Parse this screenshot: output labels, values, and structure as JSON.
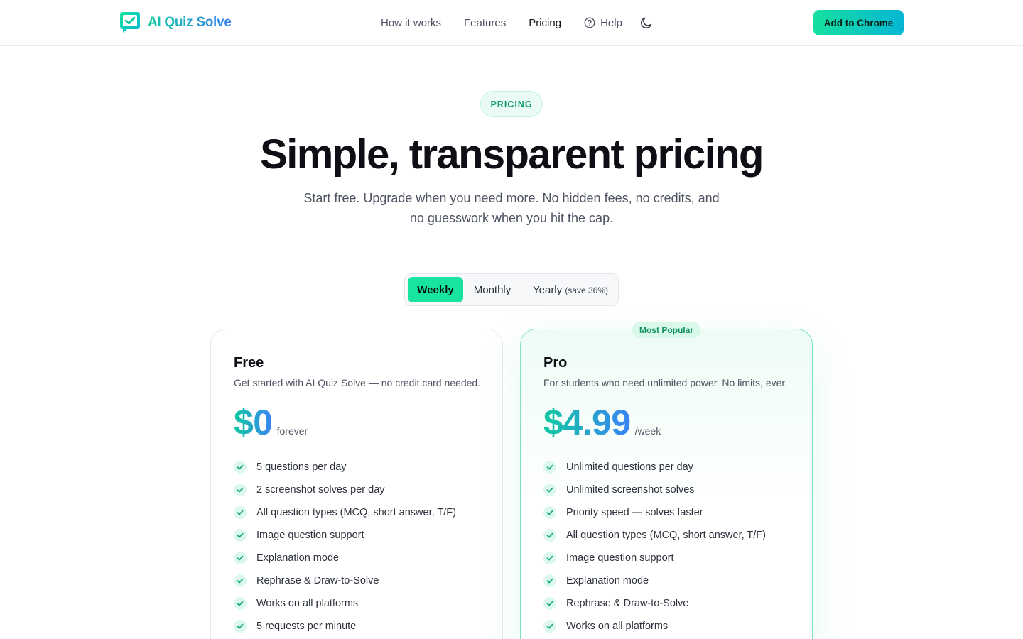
{
  "header": {
    "brand": "AI Quiz Solve",
    "nav": [
      {
        "label": "How it works",
        "active": false
      },
      {
        "label": "Features",
        "active": false
      },
      {
        "label": "Pricing",
        "active": true
      },
      {
        "label": "Help",
        "active": false,
        "icon": "help-circle-icon"
      }
    ],
    "theme_icon": "moon-icon",
    "cta_label": "Add to Chrome"
  },
  "hero": {
    "badge": "PRICING",
    "title": "Simple, transparent pricing",
    "subtitle": "Start free. Upgrade when you need more. No hidden fees, no credits, and no guesswork when you hit the cap."
  },
  "billing": {
    "weekly": "Weekly",
    "monthly": "Monthly",
    "yearly": "Yearly",
    "yearly_save": "(save 36%)",
    "selected": "Weekly"
  },
  "plans": {
    "free": {
      "name": "Free",
      "description": "Get started with AI Quiz Solve — no credit card needed.",
      "price": "$0",
      "period": "forever",
      "features": [
        "5 questions per day",
        "2 screenshot solves per day",
        "All question types (MCQ, short answer, T/F)",
        "Image question support",
        "Explanation mode",
        "Rephrase & Draw-to-Solve",
        "Works on all platforms",
        "5 requests per minute"
      ]
    },
    "pro": {
      "badge": "Most Popular",
      "name": "Pro",
      "description": "For students who need unlimited power. No limits, ever.",
      "price": "$4.99",
      "period": "/week",
      "features": [
        "Unlimited questions per day",
        "Unlimited screenshot solves",
        "Priority speed — solves faster",
        "All question types (MCQ, short answer, T/F)",
        "Image question support",
        "Explanation mode",
        "Rephrase & Draw-to-Solve",
        "Works on all platforms"
      ]
    }
  },
  "colors": {
    "accent": "#18e3a0",
    "gradient_start": "#10c9a0",
    "gradient_end": "#3b82f6"
  }
}
